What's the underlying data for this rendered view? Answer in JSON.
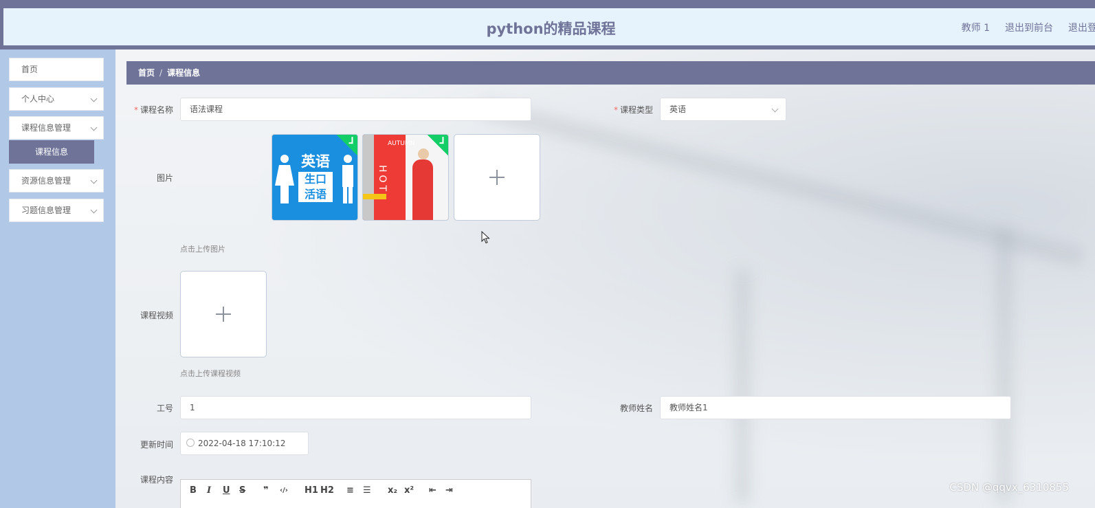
{
  "header": {
    "title": "python的精品课程",
    "nav": [
      "教师 1",
      "退出到前台",
      "退出登录"
    ]
  },
  "sidebar": {
    "items": [
      {
        "label": "首页",
        "has_arrow": false
      },
      {
        "label": "个人中心",
        "has_arrow": true
      },
      {
        "label": "课程信息管理",
        "has_arrow": true
      },
      {
        "label": "资源信息管理",
        "has_arrow": true
      },
      {
        "label": "习题信息管理",
        "has_arrow": true
      }
    ],
    "active_sub": "课程信息"
  },
  "breadcrumb": {
    "home": "首页",
    "separator": "/",
    "current": "课程信息"
  },
  "form": {
    "course_name": {
      "label": "课程名称",
      "value": "语法课程"
    },
    "course_type": {
      "label": "课程类型",
      "value": "英语"
    },
    "image": {
      "label": "图片",
      "hint": "点击上传图片"
    },
    "video": {
      "label": "课程视频",
      "hint": "点击上传课程视频"
    },
    "staff_id": {
      "label": "工号",
      "value": "1"
    },
    "teacher_name": {
      "label": "教师姓名",
      "value": "教师姓名1"
    },
    "update_time": {
      "label": "更新时间",
      "value": "2022-04-18 17:10:12"
    },
    "content": {
      "label": "课程内容"
    }
  },
  "thumbs": {
    "english": {
      "text_top": "英语",
      "text_mid": "生口",
      "text_bot": "活语"
    },
    "poster": {
      "text_side": "AUTUMN",
      "text_vert": "HOT"
    }
  },
  "toolbar": [
    "B",
    "I",
    "U",
    "S",
    "❞",
    "‹/›",
    "H1",
    "H2",
    "≡",
    "☰",
    "x₂",
    "x²",
    "⇤",
    "⇥"
  ],
  "watermark": "CSDN @qqvx_6310855",
  "colors": {
    "primary": "#6f7398",
    "sidebar": "#b1c8e6",
    "header_bg": "#e6f2fc",
    "success": "#13ce66",
    "required": "#f56c6c"
  }
}
